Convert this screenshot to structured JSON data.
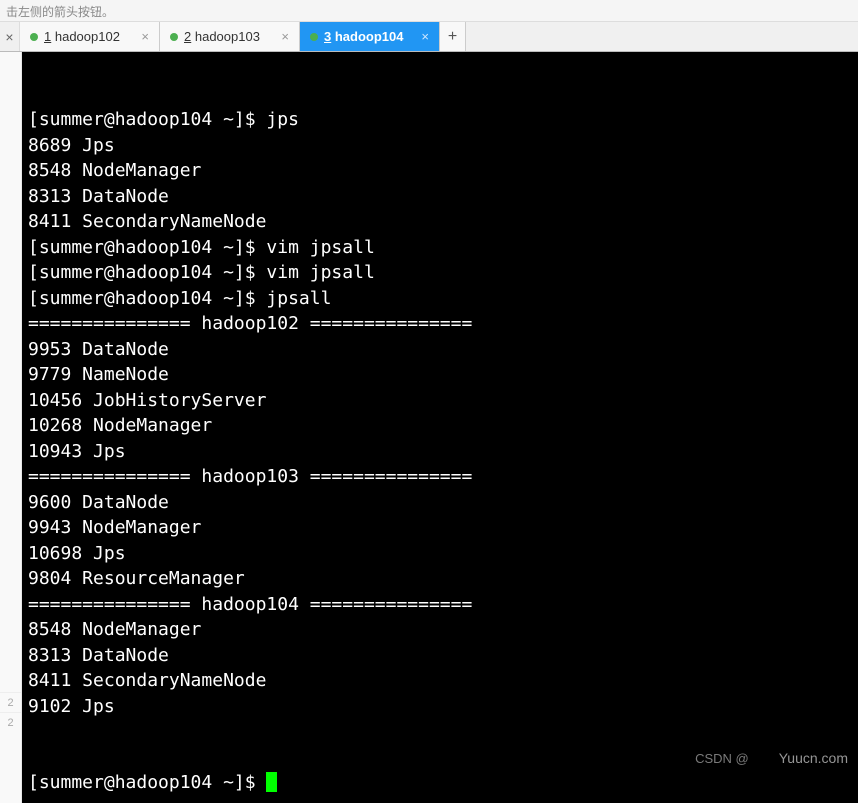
{
  "hint": "击左侧的箭头按钮。",
  "tabs": {
    "close_left": "×",
    "items": [
      {
        "num": "1",
        "label": "hadoop102",
        "active": false
      },
      {
        "num": "2",
        "label": "hadoop103",
        "active": false
      },
      {
        "num": "3",
        "label": "hadoop104",
        "active": true
      }
    ],
    "close_x": "×",
    "add": "+"
  },
  "gutter": {
    "a": "2",
    "b": "2"
  },
  "terminal": {
    "lines": [
      "[summer@hadoop104 ~]$ jps",
      "8689 Jps",
      "8548 NodeManager",
      "8313 DataNode",
      "8411 SecondaryNameNode",
      "[summer@hadoop104 ~]$ vim jpsall",
      "[summer@hadoop104 ~]$ vim jpsall",
      "[summer@hadoop104 ~]$ jpsall",
      "=============== hadoop102 ===============",
      "9953 DataNode",
      "9779 NameNode",
      "10456 JobHistoryServer",
      "10268 NodeManager",
      "10943 Jps",
      "=============== hadoop103 ===============",
      "9600 DataNode",
      "9943 NodeManager",
      "10698 Jps",
      "9804 ResourceManager",
      "=============== hadoop104 ===============",
      "8548 NodeManager",
      "8313 DataNode",
      "8411 SecondaryNameNode",
      "9102 Jps"
    ],
    "prompt": "[summer@hadoop104 ~]$ "
  },
  "watermark": {
    "csdn": "CSDN @",
    "site": "Yuucn.com"
  }
}
